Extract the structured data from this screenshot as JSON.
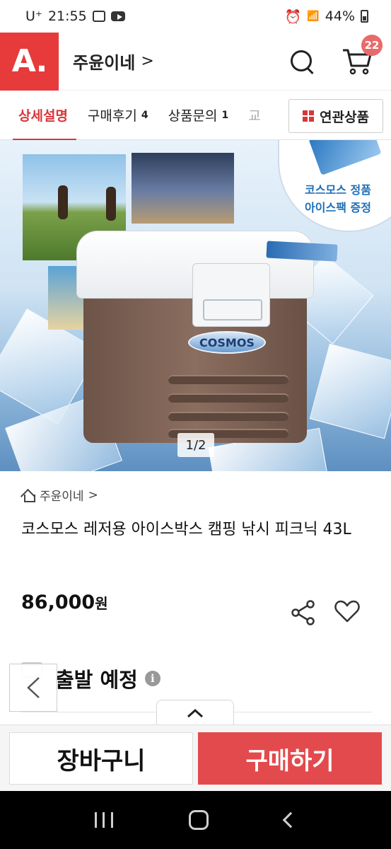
{
  "status_bar": {
    "carrier": "U⁺",
    "time": "21:55",
    "battery": "44%"
  },
  "header": {
    "logo": "A.",
    "shop_name": "주윤이네",
    "shop_chevron": ">",
    "cart_badge": "22"
  },
  "tabs": [
    {
      "label": "상세설명",
      "count": ""
    },
    {
      "label": "구매후기",
      "count": "4"
    },
    {
      "label": "상품문의",
      "count": "1"
    },
    {
      "label": "교",
      "count": ""
    }
  ],
  "related_button": "연관상품",
  "hero": {
    "promo_line1": "코스모스 정품",
    "promo_line2": "아이스팩 증정",
    "brand": "COSMOS",
    "pager": "1/2"
  },
  "product": {
    "store": "주윤이네",
    "store_chevron": ">",
    "title": "코스모스 레저용 아이스박스 캠핑 낚시 피크닉 43L",
    "price": "86,000",
    "currency": "원",
    "shipping": "출발 예정",
    "info_glyph": "i"
  },
  "actions": {
    "cart": "장바구니",
    "buy": "구매하기"
  },
  "colors": {
    "brand": "#e73a3b",
    "active_tab": "#d8363a",
    "buy_button": "#e34a4d"
  }
}
